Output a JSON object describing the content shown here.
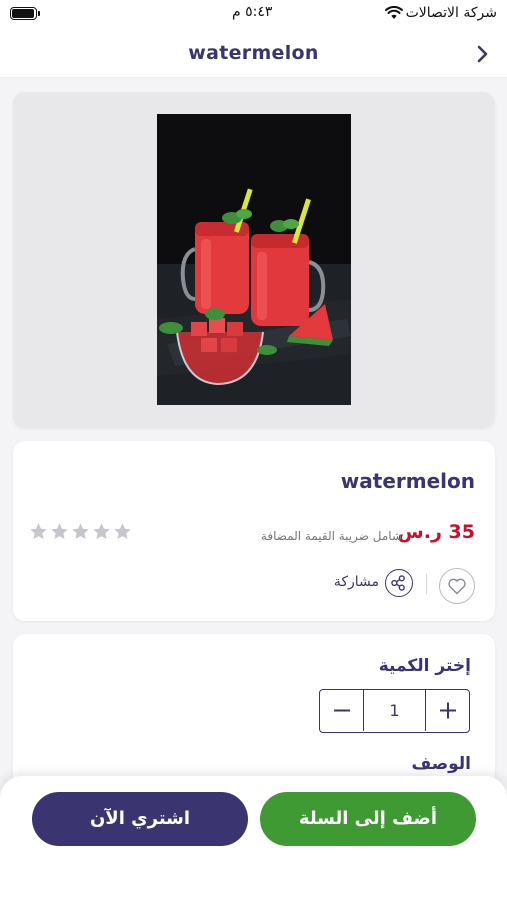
{
  "status_bar": {
    "carrier": "شركة الاتصالات",
    "time": "٥:٤٣ م"
  },
  "nav": {
    "title": "watermelon",
    "back_icon": "chevron-right-icon"
  },
  "product": {
    "name": "watermelon",
    "price": "35 ر.س",
    "vat_note": "شامل ضريبة القيمة المضافة",
    "rating": 0,
    "rating_max": 5,
    "share_label": "مشاركة"
  },
  "quantity": {
    "label": "إختر الكمية",
    "value": "1"
  },
  "description": {
    "label": "الوصف"
  },
  "actions": {
    "add_to_cart": "أضف إلى السلة",
    "buy_now": "اشتري الآن"
  },
  "colors": {
    "brand": "#3a3570",
    "price": "#c8102e",
    "cart_button": "#3f9a33",
    "star_inactive": "#c6c6cc"
  }
}
